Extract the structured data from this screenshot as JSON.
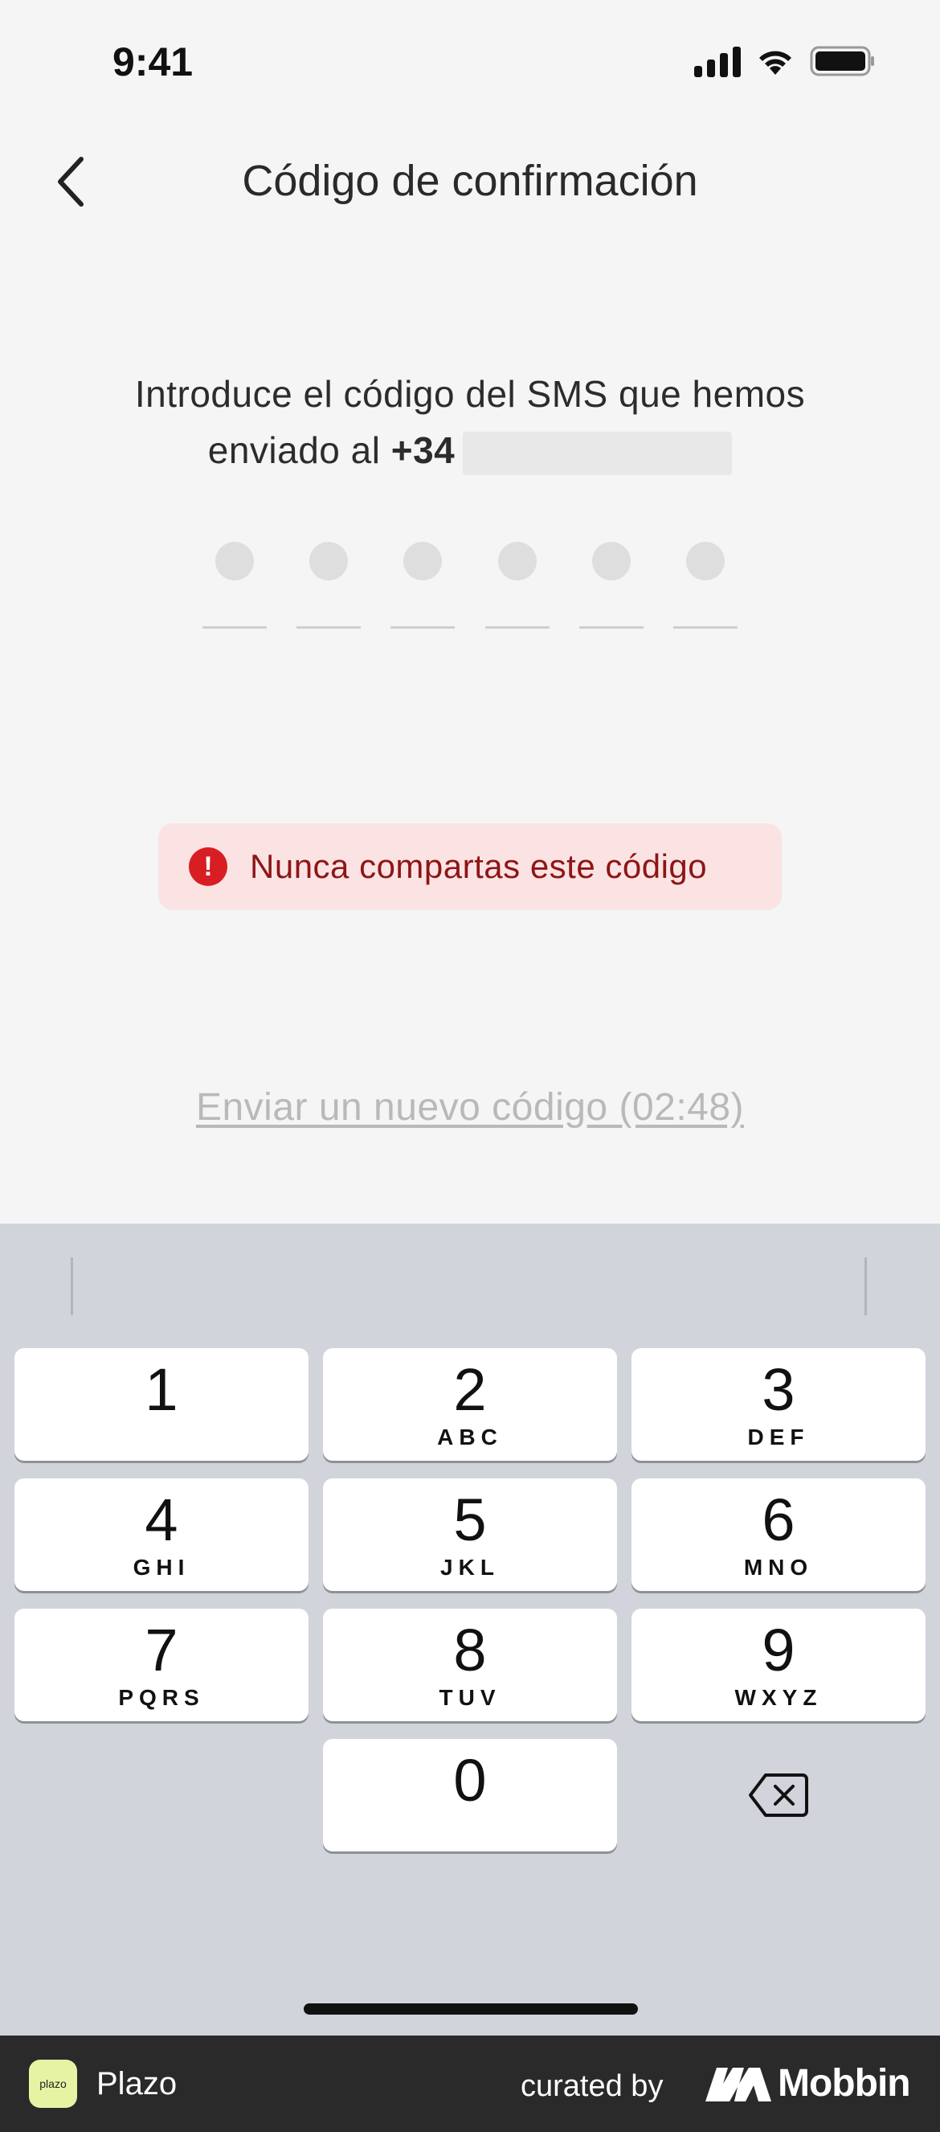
{
  "status_bar": {
    "time": "9:41"
  },
  "header": {
    "title": "Código de confirmación"
  },
  "instructions": {
    "line1": "Introduce el código del SMS que hemos",
    "line2_prefix": "enviado al ",
    "phone_prefix": "+34"
  },
  "code": {
    "length": 6,
    "filled": 0
  },
  "warning": {
    "text": "Nunca compartas este código",
    "icon": "alert-icon",
    "color": "#d91e23"
  },
  "resend": {
    "label": "Enviar un nuevo código (02:48)"
  },
  "keyboard": {
    "keys": [
      {
        "digit": "1",
        "letters": ""
      },
      {
        "digit": "2",
        "letters": "ABC"
      },
      {
        "digit": "3",
        "letters": "DEF"
      },
      {
        "digit": "4",
        "letters": "GHI"
      },
      {
        "digit": "5",
        "letters": "JKL"
      },
      {
        "digit": "6",
        "letters": "MNO"
      },
      {
        "digit": "7",
        "letters": "PQRS"
      },
      {
        "digit": "8",
        "letters": "TUV"
      },
      {
        "digit": "9",
        "letters": "WXYZ"
      },
      {
        "digit": "0",
        "letters": ""
      }
    ],
    "delete_icon": "backspace-icon"
  },
  "footer": {
    "app_logo_text": "plazo",
    "app_name": "Plazo",
    "curated_by": "curated by",
    "brand": "Mobbin"
  }
}
